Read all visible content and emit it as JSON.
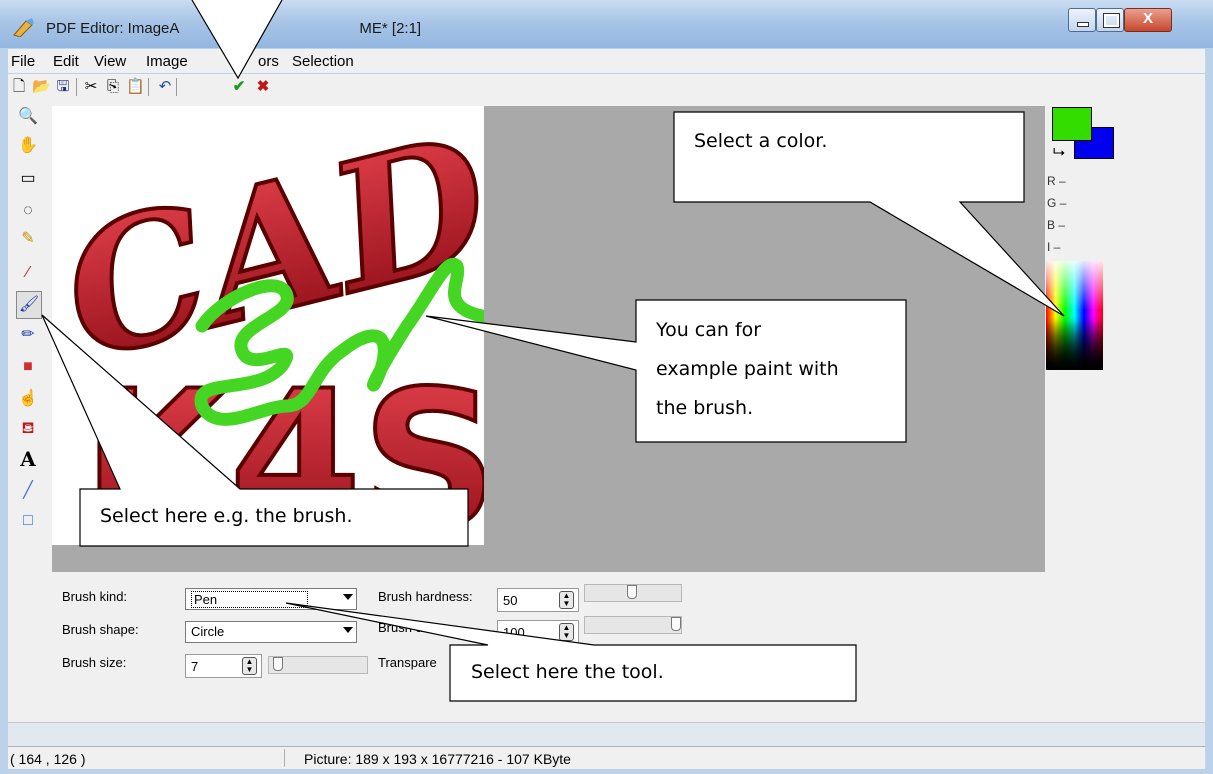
{
  "window": {
    "title": "PDF Editor: ImageA",
    "title_suffix": "ME* [2:1]"
  },
  "menu": [
    "File",
    "Edit",
    "View",
    "Image",
    "ors",
    "Selection"
  ],
  "toolbar_icons": [
    "new-icon",
    "open-icon",
    "save-icon",
    "cut-icon",
    "copy-icon",
    "paste-icon",
    "undo-icon",
    "apply-check-icon",
    "cancel-x-icon"
  ],
  "tools": [
    "zoom-tool",
    "hand-tool",
    "rect-select-tool",
    "lasso-tool",
    "magic-wand-tool",
    "eyedropper-tool",
    "brush-tool",
    "eraser-tool",
    "color-replace-tool",
    "smudge-tool",
    "fill-tool",
    "text-tool",
    "line-tool",
    "rectangle-tool"
  ],
  "colors": {
    "foreground": "#33dd00",
    "background": "#0000ee",
    "labels": [
      "R –",
      "G –",
      "B –",
      "I –"
    ]
  },
  "properties": {
    "brush_kind_label": "Brush kind:",
    "brush_kind_value": "Pen",
    "brush_shape_label": "Brush shape:",
    "brush_shape_value": "Circle",
    "brush_size_label": "Brush size:",
    "brush_size_value": "7",
    "brush_hardness_label": "Brush hardness:",
    "brush_hardness_value": "50",
    "brush_density_label": "Brush de",
    "brush_density_value": "100",
    "transparency_label": "Transpare"
  },
  "status": {
    "coords": "( 164 , 126 )",
    "picture": "Picture: 189 x 193 x 16777216 - 107 KByte"
  },
  "callouts": {
    "color": "Select a color.",
    "brush": "You can for example paint with the brush.",
    "brush_lines": [
      "You can for",
      "example paint with",
      "the brush."
    ],
    "tool": "Select here e.g. the brush.",
    "kind": "Select here the tool."
  },
  "image_text": [
    "CAD",
    "K4S"
  ]
}
